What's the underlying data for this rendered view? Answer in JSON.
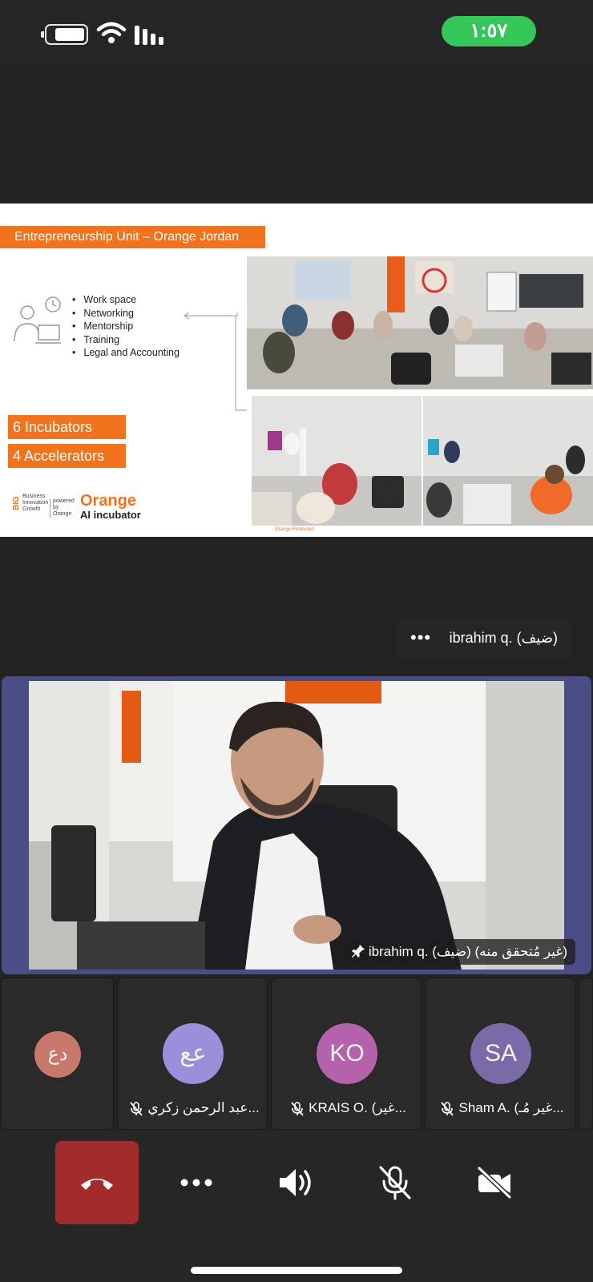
{
  "status_bar": {
    "time": "١:٥٧",
    "battery_level": 0.7,
    "accent": "#35c759"
  },
  "slide": {
    "title": "Entrepreneurship Unit – Orange Jordan",
    "bullets": [
      "Work space",
      "Networking",
      "Mentorship",
      "Training",
      "Legal and Accounting"
    ],
    "incubators": "6 Incubators",
    "accelerators": "4 Accelerators",
    "big_logo": {
      "mark": "BIG",
      "lines": [
        "Business",
        "Innovation",
        "Growth"
      ],
      "powered": "powered by Orange"
    },
    "orange_logo": "Orange",
    "ai_incubator": "AI incubator",
    "restricted": "Orange Restricted",
    "brand_color": "#f2731d"
  },
  "speaker_pill": {
    "name": "ibrahim q. (ضيف)",
    "more_icon": "more-horizontal-icon"
  },
  "main_video": {
    "label": "ibrahim q. (ضيف) (غير مُتحقق منه)",
    "pin_icon": "pin-icon",
    "border_color": "#4a4d86"
  },
  "participants": [
    {
      "initials": "دع",
      "name": "",
      "color": "#c7786a"
    },
    {
      "initials": "عع",
      "name": "عبد الرحمن زكري...",
      "color": "#9b8fdc"
    },
    {
      "initials": "KO",
      "name": "KRAIS O. (غير...",
      "color": "#b562ad"
    },
    {
      "initials": "SA",
      "name": "Sham A. (غير مُـ...",
      "color": "#7a6aa8"
    }
  ],
  "controls": {
    "end_call_color": "#a32b2b",
    "buttons": [
      "end-call",
      "more",
      "speaker",
      "mute-mic",
      "camera-off"
    ]
  }
}
